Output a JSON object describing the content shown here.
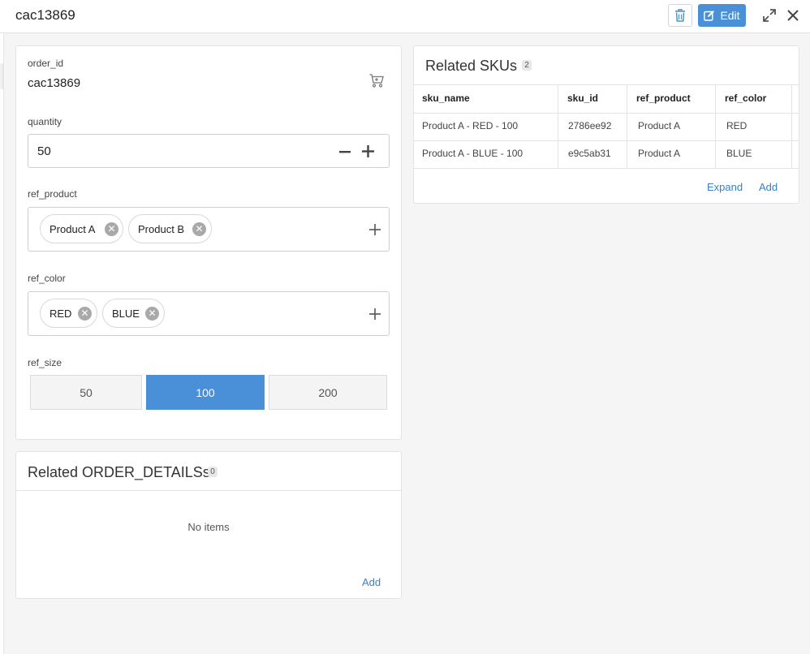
{
  "header": {
    "title": "cac13869",
    "edit_label": "Edit"
  },
  "form": {
    "order_id": {
      "label": "order_id",
      "value": "cac13869"
    },
    "quantity": {
      "label": "quantity",
      "value": "50"
    },
    "ref_product": {
      "label": "ref_product",
      "chips": [
        "Product A",
        "Product B"
      ]
    },
    "ref_color": {
      "label": "ref_color",
      "chips": [
        "RED",
        "BLUE"
      ]
    },
    "ref_size": {
      "label": "ref_size",
      "options": [
        "50",
        "100",
        "200"
      ],
      "selected": "100"
    }
  },
  "order_details": {
    "title": "Related ORDER_DETAILSs",
    "count": "0",
    "empty_text": "No items",
    "add_label": "Add"
  },
  "skus": {
    "title": "Related SKUs",
    "count": "2",
    "columns": [
      "sku_name",
      "sku_id",
      "ref_product",
      "ref_color"
    ],
    "rows": [
      [
        "Product A - RED - 100",
        "2786ee92",
        "Product A",
        "RED"
      ],
      [
        "Product A - BLUE - 100",
        "e9c5ab31",
        "Product A",
        "BLUE"
      ]
    ],
    "expand_label": "Expand",
    "add_label": "Add"
  },
  "colors": {
    "accent": "#4a90d9",
    "link": "#3a7fc8"
  },
  "icons": [
    "trash-icon",
    "edit-icon",
    "expand-icon",
    "close-icon",
    "cart-icon",
    "minus-icon",
    "plus-icon",
    "remove-chip-icon"
  ]
}
